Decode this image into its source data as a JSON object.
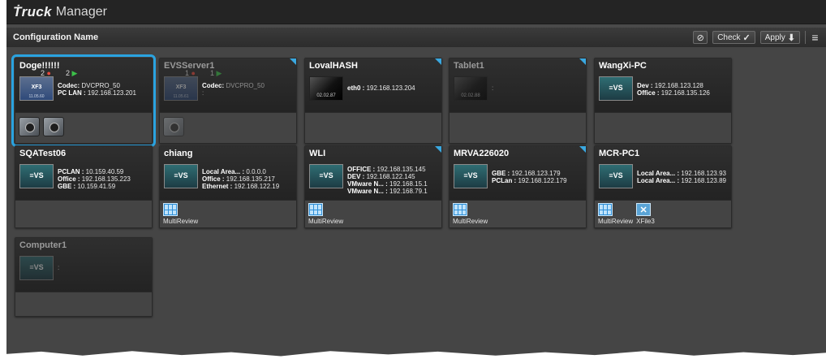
{
  "app": {
    "title_logo": "Ṫruck",
    "title_sub": "Manager"
  },
  "toolbar": {
    "config_name": "Configuration Name",
    "link_icon": "link-icon",
    "check_label": "Check",
    "check_symbol": "✓",
    "apply_label": "Apply",
    "apply_symbol": "⬇",
    "menu_symbol": "≡"
  },
  "cards": [
    {
      "name": "Doge!!!!!!",
      "thumb": "xf3",
      "thumb_label": "XF3",
      "thumb_sub": "11.05.60",
      "status": {
        "red_count": "2",
        "green_count": "2"
      },
      "info": [
        {
          "key": "Codec:",
          "val": "DVCPRO_50"
        },
        {
          "key": "PC LAN :",
          "val": "192.168.123.201"
        }
      ],
      "bottom": "cams",
      "cams": 2,
      "selected": true
    },
    {
      "name": "EVSServer1",
      "thumb": "xf3",
      "thumb_label": "XF3",
      "thumb_sub": "11.05.61",
      "status": {
        "red_count": "1",
        "green_count": "1"
      },
      "info": [
        {
          "key": "Codec:",
          "val": "DVCPRO_50"
        },
        {
          "key": "",
          "val": ":"
        }
      ],
      "bottom": "cams",
      "cams": 1,
      "dim": true,
      "corner": true
    },
    {
      "name": "LovalHASH",
      "thumb": "tablet",
      "thumb_label": "",
      "thumb_sub": "02.02.87",
      "info": [
        {
          "key": "eth0 :",
          "val": "192.168.123.204"
        }
      ],
      "corner": true
    },
    {
      "name": "Tablet1",
      "thumb": "tablet",
      "thumb_label": "",
      "thumb_sub": "02.02.88",
      "info": [
        {
          "key": "",
          "val": ":"
        }
      ],
      "dim": true,
      "corner": true
    },
    {
      "name": "WangXi-PC",
      "thumb": "evs",
      "thumb_label": "≡VS",
      "thumb_sub": "",
      "info": [
        {
          "key": "Dev :",
          "val": "192.168.123.128"
        },
        {
          "key": "Office :",
          "val": "192.168.135.126"
        }
      ]
    },
    {
      "name": "SQATest06",
      "thumb": "evs",
      "thumb_label": "≡VS",
      "thumb_sub": "",
      "info": [
        {
          "key": "PCLAN :",
          "val": "10.159.40.59"
        },
        {
          "key": "Office :",
          "val": "192.168.135.223"
        },
        {
          "key": "GBE :",
          "val": "10.159.41.59"
        }
      ]
    },
    {
      "name": "chiang",
      "thumb": "evs",
      "thumb_label": "≡VS",
      "thumb_sub": "",
      "info": [
        {
          "key": "Local Area... :",
          "val": "0.0.0.0"
        },
        {
          "key": "Office :",
          "val": "192.168.135.217"
        },
        {
          "key": "Ethernet :",
          "val": "192.168.122.19"
        }
      ],
      "apps": [
        {
          "label": "MultiReview",
          "sub": "03.03.02",
          "kind": "grid"
        }
      ]
    },
    {
      "name": "WLI",
      "thumb": "evs",
      "thumb_label": "≡VS",
      "thumb_sub": "",
      "info": [
        {
          "key": "OFFICE :",
          "val": "192.168.135.145"
        },
        {
          "key": "DEV :",
          "val": "192.168.122.145"
        },
        {
          "key": "VMware N... :",
          "val": "192.168.15.1"
        },
        {
          "key": "VMware N... :",
          "val": "192.168.79.1"
        }
      ],
      "apps": [
        {
          "label": "MultiReview",
          "sub": "03.03.04",
          "kind": "grid"
        }
      ],
      "corner": true
    },
    {
      "name": "MRVA226020",
      "thumb": "evs",
      "thumb_label": "≡VS",
      "thumb_sub": "",
      "info": [
        {
          "key": "GBE :",
          "val": "192.168.123.179"
        },
        {
          "key": "PCLan :",
          "val": "192.168.122.179"
        }
      ],
      "apps": [
        {
          "label": "MultiReview",
          "sub": "03.03.04",
          "kind": "grid"
        }
      ],
      "corner": true
    },
    {
      "name": "MCR-PC1",
      "thumb": "evs",
      "thumb_label": "≡VS",
      "thumb_sub": "",
      "info": [
        {
          "key": "Local Area... :",
          "val": "192.168.123.93"
        },
        {
          "key": "Local Area... :",
          "val": "192.168.123.89"
        }
      ],
      "apps": [
        {
          "label": "MultiReview",
          "sub": "03.03.10",
          "kind": "grid"
        },
        {
          "label": "XFile3",
          "sub": "03.07.12",
          "kind": "xfile"
        }
      ]
    },
    {
      "name": "Computer1",
      "thumb": "evs",
      "thumb_label": "≡VS",
      "thumb_sub": "",
      "info": [
        {
          "key": "",
          "val": ":"
        }
      ],
      "dim": true
    }
  ],
  "colors": {
    "selected_outline": "#2aa3e0",
    "corner_accent": "#3aa8e0",
    "status_red": "#e84a3d",
    "status_green": "#3cc049"
  }
}
